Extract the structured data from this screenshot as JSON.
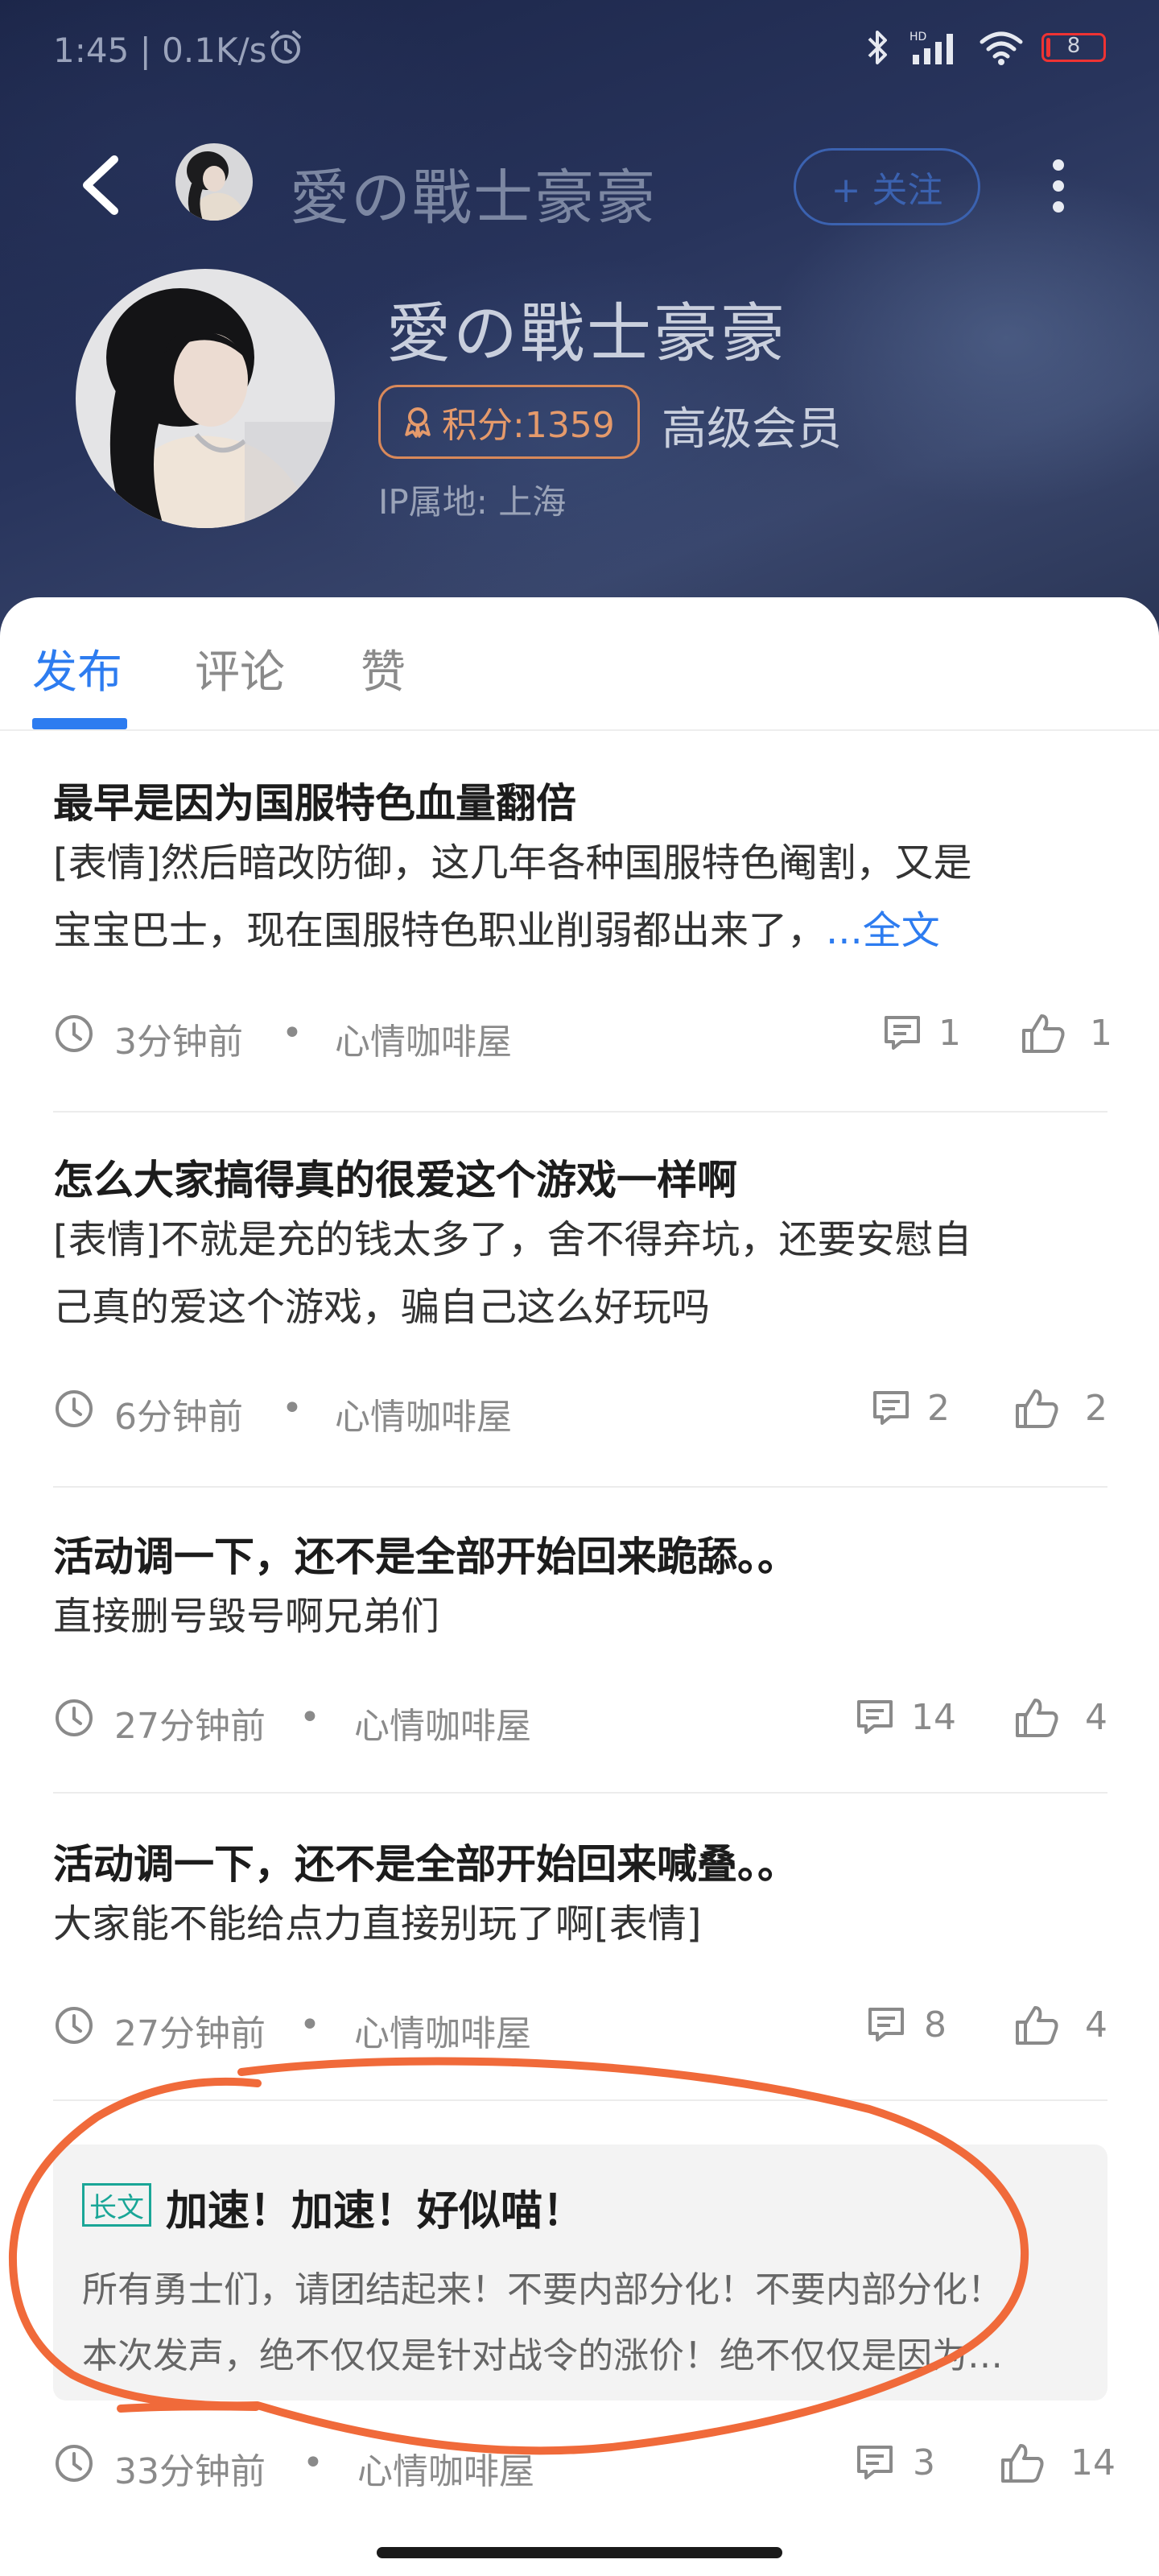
{
  "status_bar": {
    "time": "1:45 | 0.1K/s",
    "battery": "8",
    "battery_level_percent": 8,
    "icons": [
      "alarm-icon",
      "bluetooth-icon",
      "cellular-signal-icon",
      "wifi-icon",
      "battery-icon"
    ]
  },
  "topbar": {
    "title": "愛の戰士豪豪",
    "follow_label": "+ 关注"
  },
  "profile": {
    "name": "愛の戰士豪豪",
    "points": "积分:1359",
    "level": "高级会员",
    "ip_location": "IP属地: 上海"
  },
  "tabs": [
    {
      "label": "发布",
      "active": true
    },
    {
      "label": "评论",
      "active": false
    },
    {
      "label": "赞",
      "active": false
    }
  ],
  "posts": [
    {
      "title": "最早是因为国服特色血量翻倍",
      "body_lines": [
        "[表情]然后暗改防御，这几年各种国服特色阉割，又是",
        "宝宝巴士，现在国服特色职业削弱都出来了，"
      ],
      "read_more": "...全文",
      "time": "3分钟前",
      "board": "心情咖啡屋",
      "comments": "1",
      "likes": "1"
    },
    {
      "title": "怎么大家搞得真的很爱这个游戏一样啊",
      "body_lines": [
        "[表情]不就是充的钱太多了，舍不得弃坑，还要安慰自",
        "己真的爱这个游戏，骗自己这么好玩吗"
      ],
      "time": "6分钟前",
      "board": "心情咖啡屋",
      "comments": "2",
      "likes": "2"
    },
    {
      "title": "活动调一下，还不是全部开始回来跪舔。。",
      "body_lines": [
        "直接删号毁号啊兄弟们"
      ],
      "time": "27分钟前",
      "board": "心情咖啡屋",
      "comments": "14",
      "likes": "4"
    },
    {
      "title": "活动调一下，还不是全部开始回来喊叠。。",
      "body_lines": [
        "大家能不能给点力直接别玩了啊[表情]"
      ],
      "time": "27分钟前",
      "board": "心情咖啡屋",
      "comments": "8",
      "likes": "4"
    }
  ],
  "long_post": {
    "tag": "长文",
    "title": "加速！加速！好似喵！",
    "excerpt_lines": [
      "所有勇士们，请团结起来！不要内部分化！不要内部分化！",
      "本次发声，绝不仅仅是针对战令的涨价！绝不仅仅是因为…"
    ],
    "time": "33分钟前",
    "board": "心情咖啡屋",
    "comments": "3",
    "likes": "14"
  },
  "colors": {
    "accent": "#2d7cf0",
    "points_badge": "#e59a6b",
    "long_tag": "#1aa697",
    "annotation": "#f06a3a"
  }
}
